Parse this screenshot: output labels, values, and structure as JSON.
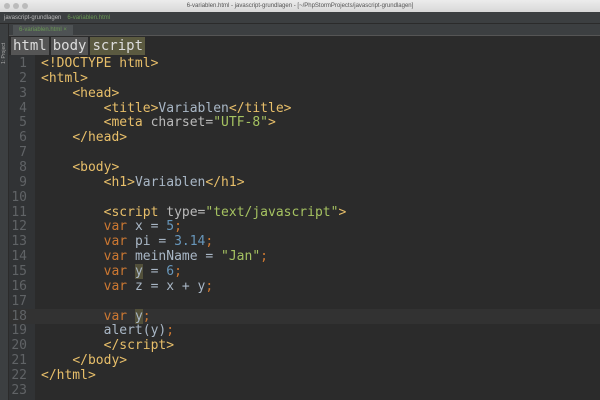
{
  "window": {
    "title": "6-variablen.html - javascript-grundlagen - [~/PhpStormProjects/javascript-grundlagen]"
  },
  "nav": {
    "project": "javascript-grundlagen",
    "file": "6-variablen.html"
  },
  "sidebar": {
    "project_label": "1: Project"
  },
  "tabs": [
    {
      "label": "6-variablen.html"
    }
  ],
  "breadcrumb": [
    "html",
    "body",
    "script"
  ],
  "current_line": 18,
  "lines": [
    [
      [
        "tag",
        "<!DOCTYPE html>"
      ]
    ],
    [
      [
        "tag",
        "<html>"
      ]
    ],
    [
      [
        "txt",
        "    "
      ],
      [
        "tag",
        "<head>"
      ]
    ],
    [
      [
        "txt",
        "        "
      ],
      [
        "tag",
        "<title>"
      ],
      [
        "txt",
        "Variablen"
      ],
      [
        "tag",
        "</title>"
      ]
    ],
    [
      [
        "txt",
        "        "
      ],
      [
        "tag",
        "<meta "
      ],
      [
        "attr",
        "charset="
      ],
      [
        "str",
        "\"UTF-8\""
      ],
      [
        "tag",
        ">"
      ]
    ],
    [
      [
        "txt",
        "    "
      ],
      [
        "tag",
        "</head>"
      ]
    ],
    [],
    [
      [
        "txt",
        "    "
      ],
      [
        "tag",
        "<body>"
      ]
    ],
    [
      [
        "txt",
        "        "
      ],
      [
        "tag",
        "<h1>"
      ],
      [
        "txt",
        "Variablen"
      ],
      [
        "tag",
        "</h1>"
      ]
    ],
    [],
    [
      [
        "txt",
        "        "
      ],
      [
        "tag",
        "<script "
      ],
      [
        "attr",
        "type="
      ],
      [
        "str",
        "\"text/javascript\""
      ],
      [
        "tag",
        ">"
      ]
    ],
    [
      [
        "txt",
        "        "
      ],
      [
        "kw",
        "var "
      ],
      [
        "txt",
        "x = "
      ],
      [
        "num",
        "5"
      ],
      [
        "kw",
        ";"
      ]
    ],
    [
      [
        "txt",
        "        "
      ],
      [
        "kw",
        "var "
      ],
      [
        "txt",
        "pi = "
      ],
      [
        "num",
        "3.14"
      ],
      [
        "kw",
        ";"
      ]
    ],
    [
      [
        "txt",
        "        "
      ],
      [
        "kw",
        "var "
      ],
      [
        "txt",
        "meinName = "
      ],
      [
        "str",
        "\"Jan\""
      ],
      [
        "kw",
        ";"
      ]
    ],
    [
      [
        "txt",
        "        "
      ],
      [
        "kw",
        "var "
      ],
      [
        "hl",
        "y"
      ],
      [
        "txt",
        " = "
      ],
      [
        "num",
        "6"
      ],
      [
        "kw",
        ";"
      ]
    ],
    [
      [
        "txt",
        "        "
      ],
      [
        "kw",
        "var "
      ],
      [
        "txt",
        "z = x + y"
      ],
      [
        "kw",
        ";"
      ]
    ],
    [],
    [
      [
        "txt",
        "        "
      ],
      [
        "kw",
        "var "
      ],
      [
        "hl",
        "y"
      ],
      [
        "kw",
        ";"
      ]
    ],
    [
      [
        "txt",
        "        alert(y)"
      ],
      [
        "kw",
        ";"
      ]
    ],
    [
      [
        "txt",
        "        "
      ],
      [
        "tag",
        "</script>"
      ]
    ],
    [
      [
        "txt",
        "    "
      ],
      [
        "tag",
        "</body>"
      ]
    ],
    [
      [
        "tag",
        "</html>"
      ]
    ],
    []
  ]
}
